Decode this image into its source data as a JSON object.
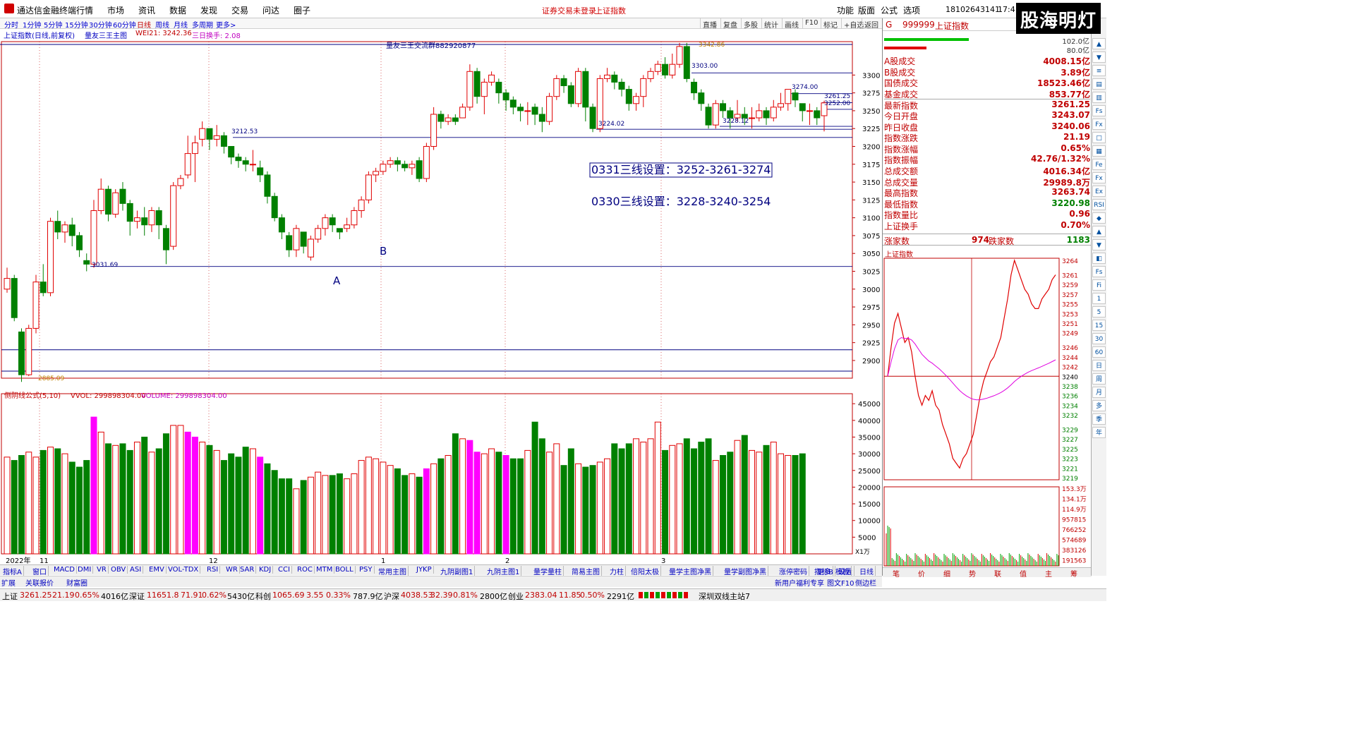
{
  "window": {
    "app_name": "通达信金融终端",
    "notice": "证券交易未登录",
    "notice2": "上证指数",
    "user": "18102643141",
    "clock": "17:4",
    "brand": "股海明灯"
  },
  "menu": [
    "行情",
    "市场",
    "资讯",
    "数据",
    "发现",
    "交易",
    "问达",
    "圈子"
  ],
  "right_menu": [
    "功能",
    "版面",
    "公式",
    "选项"
  ],
  "period_tabs": [
    "分时",
    "1分钟",
    "5分钟",
    "15分钟",
    "30分钟",
    "60分钟",
    "日线",
    "周线",
    "月线",
    "多周期",
    "更多>"
  ],
  "chart_tools": [
    "直播",
    "复盘",
    "多股",
    "统计",
    "画线",
    "F10",
    "标记",
    "+自选",
    "返回"
  ],
  "info": {
    "index": "上证指数(日线,前复权)",
    "formula": "量友三王主图",
    "wei": "WEI21: 3242.36",
    "turnover": "三日换手: 2.08",
    "group": "量友三王交流群882920877"
  },
  "annotations": {
    "line1": "0331三线设置：3252-3261-3274",
    "line2": "0330三线设置：3228-3240-3254",
    "A": "A",
    "B": "B"
  },
  "price_labels": {
    "high": "3342.86",
    "l3303": "3303.00",
    "l3274": "3274.00",
    "l3261": "3261.25",
    "l3252": "3252.00",
    "l3228": "3228.12",
    "l3224": "3224.02",
    "l3212": "3212.53",
    "l3031": "3031.69",
    "low": "2885.09"
  },
  "y_ticks": [
    "3300",
    "3275",
    "3250",
    "3225",
    "3200",
    "3175",
    "3150",
    "3125",
    "3100",
    "3075",
    "3050",
    "3025",
    "3000",
    "2975",
    "2950",
    "2925",
    "2900"
  ],
  "vol_ticks": [
    "45000",
    "40000",
    "35000",
    "30000",
    "25000",
    "20000",
    "15000",
    "10000",
    "5000"
  ],
  "vol_unit": "X1万",
  "vol_info": {
    "formula": "侧阴线公式(5,10)",
    "vvol": "VVOL: 299898304.00",
    "volume": "VOLUME: 299898304.00"
  },
  "months": [
    "2022年",
    "11",
    "12",
    "1",
    "2",
    "3"
  ],
  "bottom_tabs": [
    "指标A",
    "窗口",
    "MACD",
    "DMI",
    "VR",
    "OBV",
    "ASI",
    "EMV",
    "VOL-TDX",
    "RSI",
    "WR",
    "SAR",
    "KDJ",
    "CCI",
    "ROC",
    "MTM",
    "BOLL",
    "PSY",
    "常用主图",
    "JYKP",
    "九阴副图1",
    "九阴主图1",
    "量学量柱",
    "简易主图",
    "力柱",
    "倍阳太极",
    "量学主图净黑",
    "量学副图净黑",
    "涨停密码",
    "更多",
    "设置"
  ],
  "bottom_tabs2": [
    "扩展",
    "关联报价",
    "财富圈"
  ],
  "bottom_right": [
    "指标B",
    "模板",
    "日线"
  ],
  "bottom_right2": [
    "新用户福利专享",
    "图文F10",
    "侧边栏"
  ],
  "quote": {
    "code": "999999",
    "name": "上证指数",
    "prefix": "G",
    "rows": [
      {
        "k": "A股成交",
        "v": "4008.15亿"
      },
      {
        "k": "B股成交",
        "v": "3.89亿"
      },
      {
        "k": "国债成交",
        "v": "18523.46亿"
      },
      {
        "k": "基金成交",
        "v": "853.77亿"
      },
      {
        "k": "最新指数",
        "v": "3261.25"
      },
      {
        "k": "今日开盘",
        "v": "3243.07"
      },
      {
        "k": "昨日收盘",
        "v": "3240.06"
      },
      {
        "k": "指数涨跌",
        "v": "21.19"
      },
      {
        "k": "指数涨幅",
        "v": "0.65%"
      },
      {
        "k": "指数振幅",
        "v": "42.76/1.32%"
      },
      {
        "k": "总成交额",
        "v": "4016.34亿"
      },
      {
        "k": "总成交量",
        "v": "29989.8万"
      },
      {
        "k": "最高指数",
        "v": "3263.74"
      },
      {
        "k": "最低指数",
        "v": "3220.98"
      },
      {
        "k": "指数量比",
        "v": "0.96"
      },
      {
        "k": "上证换手",
        "v": "0.70%"
      }
    ],
    "rise_label": "涨家数",
    "rise": "974",
    "fall_label": "跌家数",
    "fall": "1183",
    "top1": "102.0亿",
    "top2": "80.0亿"
  },
  "intraday": {
    "title": "上证指数",
    "ticks": [
      "3264",
      "3261",
      "3259",
      "3257",
      "3255",
      "3253",
      "3251",
      "3249",
      "3246",
      "3244",
      "3242",
      "3240",
      "3238",
      "3236",
      "3234",
      "3232",
      "3229",
      "3227",
      "3225",
      "3223",
      "3221",
      "3219"
    ],
    "vol_ticks": [
      "153.3万",
      "134.1万",
      "114.9万",
      "957815",
      "766252",
      "574689",
      "383126",
      "191563"
    ]
  },
  "intraday_tabs": [
    "笔",
    "价",
    "细",
    "势",
    "联",
    "值",
    "主",
    "筹"
  ],
  "sidebar_icons": [
    "▲",
    "▼",
    "≡",
    "▤",
    "▥",
    "Fs",
    "Fx",
    "□",
    "▦",
    "Fe",
    "Fx",
    "Ex",
    "RSI",
    "◆",
    "▲",
    "▼",
    "◧",
    "Fs",
    "Fi",
    "1",
    "5",
    "15",
    "30",
    "60",
    "日",
    "周",
    "月",
    "多",
    "季",
    "年"
  ],
  "status": {
    "sh_label": "上证",
    "sh": "3261.25",
    "sh_chg": "21.19",
    "sh_pct": "0.65%",
    "sh_amt": "4016亿",
    "sz_label": "深证",
    "sz": "11651.8",
    "sz_chg": "71.91",
    "sz_pct": "0.62%",
    "sz_amt": "5430亿",
    "kc_label": "科创",
    "kc": "1065.69",
    "kc_chg": "3.55",
    "kc_pct": "0.33%",
    "kc_amt": "787.9亿",
    "hs_label": "沪深",
    "hs": "4038.53",
    "hs_chg": "32.39",
    "hs_pct": "0.81%",
    "hs_amt": "2800亿",
    "cy_label": "创业",
    "cy": "2383.04",
    "cy_chg": "11.85",
    "cy_pct": "0.50%",
    "cy_amt": "2291亿",
    "server": "深圳双线主站7"
  },
  "chart_data": {
    "type": "candlestick",
    "ylim": [
      2885,
      3345
    ],
    "candles": [
      [
        3000,
        3015,
        3030,
        2995
      ],
      [
        3015,
        2960,
        3020,
        2955
      ],
      [
        2940,
        2880,
        2945,
        2870
      ],
      [
        2880,
        2945,
        2950,
        2878
      ],
      [
        2945,
        3010,
        3020,
        2938
      ],
      [
        3010,
        2995,
        3035,
        2990
      ],
      [
        2995,
        3095,
        3100,
        2990
      ],
      [
        3095,
        3080,
        3110,
        3070
      ],
      [
        3080,
        3090,
        3095,
        3065
      ],
      [
        3090,
        3075,
        3100,
        3060
      ],
      [
        3075,
        3055,
        3080,
        3045
      ],
      [
        3040,
        3035,
        3050,
        3025
      ],
      [
        3035,
        3110,
        3125,
        3030
      ],
      [
        3110,
        3140,
        3155,
        3105
      ],
      [
        3140,
        3105,
        3145,
        3095
      ],
      [
        3105,
        3135,
        3140,
        3100
      ],
      [
        3140,
        3120,
        3150,
        3110
      ],
      [
        3120,
        3095,
        3125,
        3075
      ],
      [
        3095,
        3100,
        3110,
        3085
      ],
      [
        3100,
        3090,
        3115,
        3075
      ],
      [
        3090,
        3110,
        3115,
        3080
      ],
      [
        3110,
        3090,
        3115,
        3070
      ],
      [
        3085,
        3055,
        3090,
        3035
      ],
      [
        3060,
        3145,
        3150,
        3055
      ],
      [
        3145,
        3155,
        3160,
        3140
      ],
      [
        3160,
        3190,
        3215,
        3155
      ],
      [
        3190,
        3205,
        3215,
        3150
      ],
      [
        3210,
        3225,
        3235,
        3200
      ],
      [
        3225,
        3210,
        3225,
        3195
      ],
      [
        3210,
        3215,
        3230,
        3200
      ],
      [
        3215,
        3200,
        3220,
        3190
      ],
      [
        3200,
        3185,
        3200,
        3175
      ],
      [
        3185,
        3180,
        3190,
        3170
      ],
      [
        3180,
        3175,
        3185,
        3165
      ],
      [
        3175,
        3175,
        3195,
        3165
      ],
      [
        3170,
        3160,
        3180,
        3150
      ],
      [
        3160,
        3130,
        3165,
        3120
      ],
      [
        3130,
        3100,
        3135,
        3095
      ],
      [
        3100,
        3080,
        3105,
        3070
      ],
      [
        3075,
        3055,
        3080,
        3045
      ],
      [
        3055,
        3085,
        3090,
        3045
      ],
      [
        3080,
        3060,
        3075,
        3050
      ],
      [
        3045,
        3070,
        3075,
        3040
      ],
      [
        3070,
        3085,
        3090,
        3065
      ],
      [
        3085,
        3100,
        3105,
        3075
      ],
      [
        3100,
        3090,
        3105,
        3080
      ],
      [
        3085,
        3080,
        3085,
        3070
      ],
      [
        3085,
        3090,
        3100,
        3080
      ],
      [
        3090,
        3110,
        3115,
        3085
      ],
      [
        3110,
        3125,
        3130,
        3100
      ],
      [
        3125,
        3160,
        3165,
        3120
      ],
      [
        3160,
        3165,
        3170,
        3150
      ],
      [
        3165,
        3175,
        3180,
        3160
      ],
      [
        3175,
        3180,
        3185,
        3170
      ],
      [
        3180,
        3175,
        3185,
        3165
      ],
      [
        3175,
        3170,
        3180,
        3165
      ],
      [
        3170,
        3175,
        3180,
        3160
      ],
      [
        3180,
        3155,
        3185,
        3150
      ],
      [
        3155,
        3200,
        3205,
        3150
      ],
      [
        3200,
        3245,
        3255,
        3195
      ],
      [
        3245,
        3235,
        3250,
        3225
      ],
      [
        3235,
        3240,
        3245,
        3230
      ],
      [
        3240,
        3235,
        3245,
        3230
      ],
      [
        3240,
        3255,
        3260,
        3240
      ],
      [
        3255,
        3305,
        3315,
        3250
      ],
      [
        3305,
        3270,
        3310,
        3260
      ],
      [
        3270,
        3290,
        3295,
        3245
      ],
      [
        3290,
        3300,
        3305,
        3285
      ],
      [
        3290,
        3275,
        3295,
        3260
      ],
      [
        3275,
        3265,
        3280,
        3250
      ],
      [
        3265,
        3255,
        3270,
        3245
      ],
      [
        3255,
        3250,
        3260,
        3235
      ],
      [
        3250,
        3250,
        3262,
        3230
      ],
      [
        3255,
        3245,
        3260,
        3230
      ],
      [
        3245,
        3235,
        3255,
        3220
      ],
      [
        3235,
        3270,
        3275,
        3230
      ],
      [
        3270,
        3295,
        3300,
        3265
      ],
      [
        3295,
        3285,
        3300,
        3275
      ],
      [
        3285,
        3260,
        3290,
        3255
      ],
      [
        3260,
        3305,
        3310,
        3255
      ],
      [
        3305,
        3255,
        3310,
        3235
      ],
      [
        3255,
        3225,
        3260,
        3220
      ],
      [
        3225,
        3295,
        3300,
        3220
      ],
      [
        3295,
        3300,
        3310,
        3290
      ],
      [
        3300,
        3290,
        3305,
        3280
      ],
      [
        3290,
        3280,
        3295,
        3270
      ],
      [
        3280,
        3260,
        3285,
        3250
      ],
      [
        3260,
        3270,
        3275,
        3250
      ],
      [
        3270,
        3295,
        3300,
        3255
      ],
      [
        3295,
        3305,
        3310,
        3290
      ],
      [
        3305,
        3315,
        3320,
        3300
      ],
      [
        3315,
        3300,
        3325,
        3295
      ],
      [
        3300,
        3315,
        3330,
        3295
      ],
      [
        3315,
        3340,
        3345,
        3310
      ],
      [
        3340,
        3295,
        3345,
        3290
      ],
      [
        3290,
        3275,
        3295,
        3265
      ],
      [
        3275,
        3260,
        3280,
        3250
      ],
      [
        3255,
        3230,
        3260,
        3225
      ],
      [
        3230,
        3260,
        3265,
        3225
      ],
      [
        3260,
        3250,
        3265,
        3240
      ],
      [
        3250,
        3240,
        3255,
        3225
      ],
      [
        3240,
        3245,
        3265,
        3235
      ],
      [
        3245,
        3240,
        3255,
        3230
      ],
      [
        3240,
        3240,
        3255,
        3225
      ],
      [
        3240,
        3250,
        3260,
        3235
      ],
      [
        3250,
        3240,
        3255,
        3230
      ],
      [
        3240,
        3255,
        3265,
        3235
      ],
      [
        3255,
        3260,
        3275,
        3250
      ],
      [
        3260,
        3280,
        3280,
        3250
      ],
      [
        3275,
        3265,
        3280,
        3255
      ],
      [
        3260,
        3250,
        3260,
        3235
      ],
      [
        3250,
        3250,
        3260,
        3230
      ],
      [
        3250,
        3240,
        3255,
        3230
      ],
      [
        3243,
        3261,
        3264,
        3221
      ]
    ],
    "volume": [
      29000,
      28000,
      29500,
      30500,
      29000,
      31000,
      32000,
      31500,
      30000,
      27500,
      26000,
      28000,
      41000,
      36500,
      33000,
      32500,
      33000,
      31000,
      33500,
      35000,
      30500,
      31500,
      36000,
      38500,
      38500,
      36500,
      35000,
      33500,
      32500,
      31000,
      28000,
      30000,
      29000,
      32000,
      31500,
      29000,
      27000,
      25000,
      22500,
      22500,
      19500,
      22000,
      23000,
      24500,
      23500,
      23500,
      24000,
      22500,
      24000,
      28000,
      29000,
      28500,
      27500,
      26500,
      25500,
      23500,
      24000,
      23000,
      25500,
      27000,
      28500,
      29500,
      36000,
      34500,
      34000,
      30500,
      30000,
      31500,
      30500,
      29500,
      28500,
      28500,
      31000,
      39500,
      34500,
      30500,
      33000,
      26500,
      31500,
      27000,
      26000,
      26500,
      27500,
      28500,
      33000,
      31500,
      33000,
      34500,
      33500,
      34500,
      39500,
      31000,
      32500,
      33000,
      34500,
      31500,
      33500,
      34500,
      28000,
      29500,
      30500,
      34000,
      35500,
      31000,
      30500,
      32500,
      33500,
      30000,
      29500,
      29500,
      30000
    ],
    "intraday": [
      3240,
      3246,
      3251,
      3253,
      3250,
      3247,
      3248,
      3245,
      3240,
      3236,
      3234,
      3236,
      3235,
      3237,
      3234,
      3233,
      3230,
      3228,
      3226,
      3223,
      3222,
      3221,
      3223,
      3224,
      3226,
      3228,
      3232,
      3236,
      3239,
      3241,
      3243,
      3244,
      3246,
      3248,
      3252,
      3256,
      3261,
      3264,
      3262,
      3260,
      3258,
      3257,
      3255,
      3254,
      3254,
      3256,
      3257,
      3258,
      3260,
      3261
    ]
  }
}
